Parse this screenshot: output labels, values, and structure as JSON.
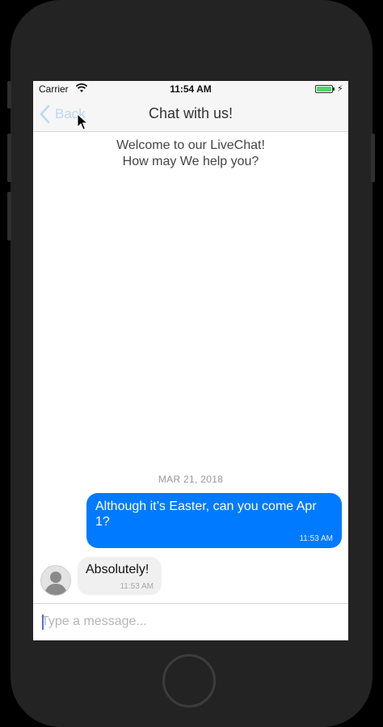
{
  "status_bar": {
    "carrier": "Carrier",
    "time": "11:54 AM",
    "battery_color": "#4cd964"
  },
  "nav": {
    "back_label": "Back",
    "title": "Chat with us!"
  },
  "chat": {
    "welcome_line1": "Welcome to our LiveChat!",
    "welcome_line2": "How may We help you?",
    "date_label": "MAR 21, 2018",
    "messages": [
      {
        "direction": "outgoing",
        "text": "Although it’s Easter, can you come Apr 1?",
        "time": "11:53 AM",
        "bubble_color": "#007aff"
      },
      {
        "direction": "incoming",
        "text": "Absolutely!",
        "time": "11:53 AM",
        "bubble_color": "#f0f0f0"
      }
    ]
  },
  "input": {
    "placeholder": "Type a message..."
  },
  "icons": {
    "back": "chevron-left-icon",
    "wifi": "wifi-icon",
    "battery": "battery-icon",
    "charging": "bolt-icon",
    "avatar": "user-avatar-icon",
    "cursor": "mouse-pointer-icon"
  }
}
